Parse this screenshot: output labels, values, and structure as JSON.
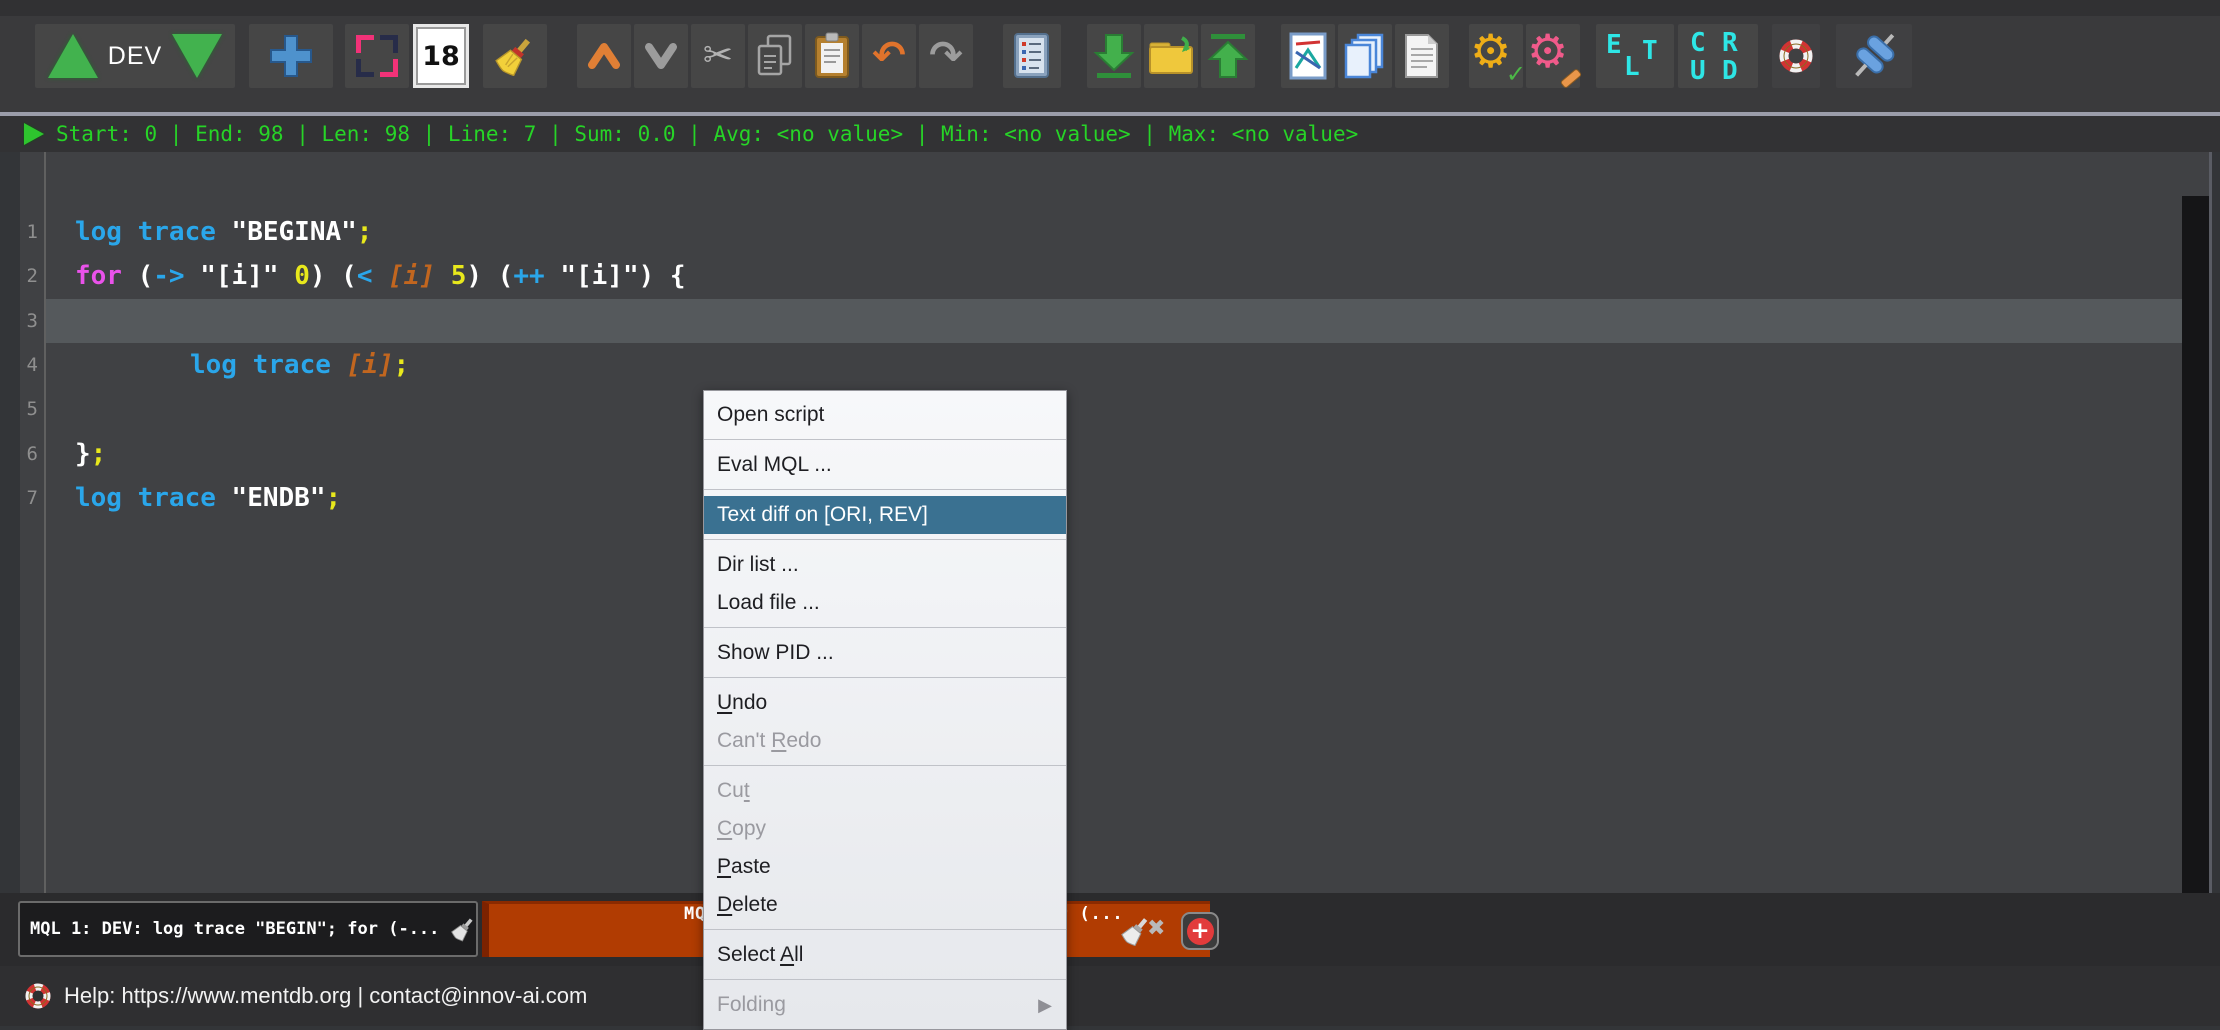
{
  "toolbar": {
    "env_label": "DEV",
    "font_size_value": "18",
    "elt_letters": [
      "E",
      "L",
      "T"
    ],
    "crud_letters": [
      "C",
      "R",
      "U",
      "D"
    ],
    "glyphs": {
      "scissors": "✂",
      "undo": "↶",
      "redo": "↷",
      "gear": "⚙",
      "check": "✓",
      "close": "✖",
      "submenu_arrow": "▶",
      "add": "+"
    }
  },
  "statusbar": {
    "text": "Start: 0 | End: 98 | Len: 98 | Line: 7 | Sum: 0.0 | Avg: <no value> | Min: <no value> | Max: <no value>"
  },
  "editor": {
    "lines": [
      {
        "num": "1",
        "indent": 0,
        "tokens": [
          [
            "kw",
            "log trace "
          ],
          [
            "str",
            "\"BEGINA\""
          ],
          [
            "end",
            ";"
          ]
        ]
      },
      {
        "num": "2",
        "indent": 0,
        "tokens": [
          [
            "ctrl",
            "for "
          ],
          [
            "pun",
            "("
          ],
          [
            "kw",
            "->"
          ],
          [
            "pun",
            " "
          ],
          [
            "str",
            "\"[i]\""
          ],
          [
            "pun",
            " "
          ],
          [
            "num",
            "0"
          ],
          [
            "pun",
            ") ("
          ],
          [
            "kw",
            "<"
          ],
          [
            "pun",
            " "
          ],
          [
            "var",
            "[i]"
          ],
          [
            "pun",
            " "
          ],
          [
            "num",
            "5"
          ],
          [
            "pun",
            ") ("
          ],
          [
            "kw",
            "++"
          ],
          [
            "pun",
            " "
          ],
          [
            "str",
            "\"[i]\""
          ],
          [
            "pun",
            ") {"
          ]
        ]
      },
      {
        "num": "3",
        "indent": 0,
        "highlight": true,
        "tokens": []
      },
      {
        "num": "4",
        "indent": 115,
        "tokens": [
          [
            "kw",
            "log trace "
          ],
          [
            "var",
            "[i]"
          ],
          [
            "end",
            ";"
          ]
        ]
      },
      {
        "num": "5",
        "indent": 0,
        "tokens": []
      },
      {
        "num": "6",
        "indent": 0,
        "tokens": [
          [
            "pun",
            "}"
          ],
          [
            "end",
            ";"
          ]
        ]
      },
      {
        "num": "7",
        "indent": 0,
        "tokens": [
          [
            "kw",
            "log trace "
          ],
          [
            "str",
            "\"ENDB\""
          ],
          [
            "end",
            ";"
          ]
        ]
      }
    ]
  },
  "context_menu": {
    "submenu_glyph": "▶",
    "items": [
      {
        "label": "Open script",
        "sep_after": true
      },
      {
        "label": "Eval MQL ...",
        "sep_after": true
      },
      {
        "label": "Text diff on [ORI, REV]",
        "highlighted": true,
        "sep_after": true
      },
      {
        "label": "Dir list ..."
      },
      {
        "label": "Load file ...",
        "sep_after": true
      },
      {
        "label": "Show PID ...",
        "sep_after": true
      },
      {
        "label": "Undo",
        "underline": 0
      },
      {
        "label": "Can't Redo",
        "underline": 6,
        "disabled": true,
        "sep_after": true
      },
      {
        "label": "Cut",
        "underline": 2,
        "disabled": true
      },
      {
        "label": "Copy",
        "underline": 0,
        "disabled": true
      },
      {
        "label": "Paste",
        "underline": 0
      },
      {
        "label": "Delete",
        "underline": 0,
        "sep_after": true
      },
      {
        "label": "Select All",
        "underline": 7,
        "sep_after": true
      },
      {
        "label": "Folding",
        "disabled": true,
        "submenu": true
      }
    ]
  },
  "tabs": {
    "tab1": {
      "label": "MQL 1: DEV: log trace \"BEGIN\"; for (-..."
    },
    "tab2": {
      "label": "MQL 2: DEV: log trace \"BEGINA\"; for (..."
    }
  },
  "help_bar": {
    "text": "Help: https://www.mentdb.org | contact@innov-ai.com"
  },
  "colors": {
    "status_green": "#27d427",
    "tab_active_orange": "#b13c02",
    "menu_highlight_blue": "#3a7191",
    "keyword_blue": "#2aa6ea",
    "flow_magenta": "#ea52ea",
    "number_yellow": "#e8e81c",
    "variable_orange": "#c2661f"
  }
}
